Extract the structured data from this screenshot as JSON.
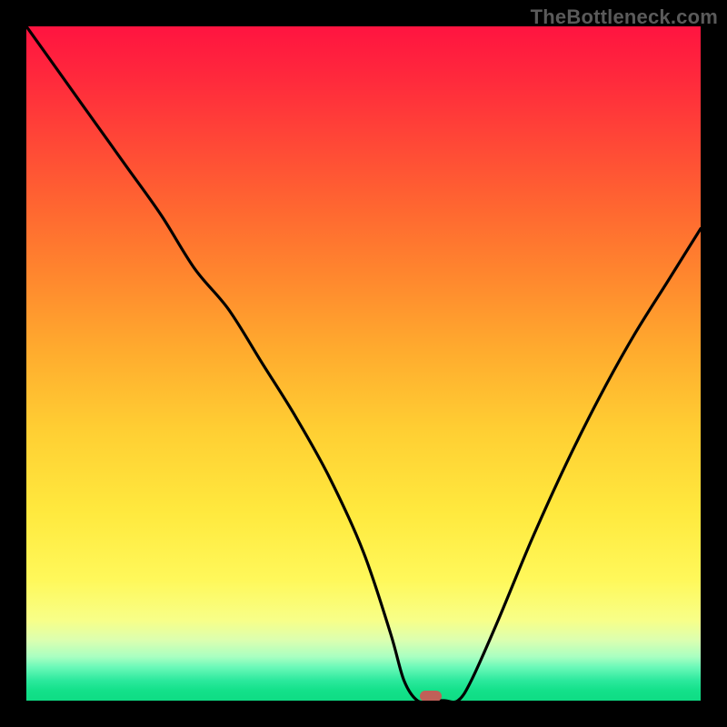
{
  "watermark": "TheBottleneck.com",
  "colors": {
    "page_bg": "#000000",
    "watermark_text": "#5a5a5a",
    "curve_stroke": "#000000",
    "marker_fill": "#c06058",
    "gradient_top": "#ff1440",
    "gradient_bottom": "#0fdc84"
  },
  "chart_data": {
    "type": "line",
    "title": "",
    "xlabel": "",
    "ylabel": "",
    "xlim": [
      0,
      100
    ],
    "ylim": [
      0,
      100
    ],
    "grid": false,
    "legend": false,
    "series": [
      {
        "name": "bottleneck-curve",
        "x": [
          0,
          5,
          10,
          15,
          20,
          25,
          30,
          35,
          40,
          45,
          50,
          54,
          56,
          58,
          60,
          62,
          64,
          66,
          70,
          75,
          80,
          85,
          90,
          95,
          100
        ],
        "values": [
          100,
          93,
          86,
          79,
          72,
          64,
          58,
          50,
          42,
          33,
          22,
          10,
          3,
          0,
          0,
          0,
          0,
          3,
          12,
          24,
          35,
          45,
          54,
          62,
          70
        ]
      }
    ],
    "marker": {
      "x": 60,
      "y": 0
    },
    "background": "vertical-gradient-red-to-green"
  }
}
